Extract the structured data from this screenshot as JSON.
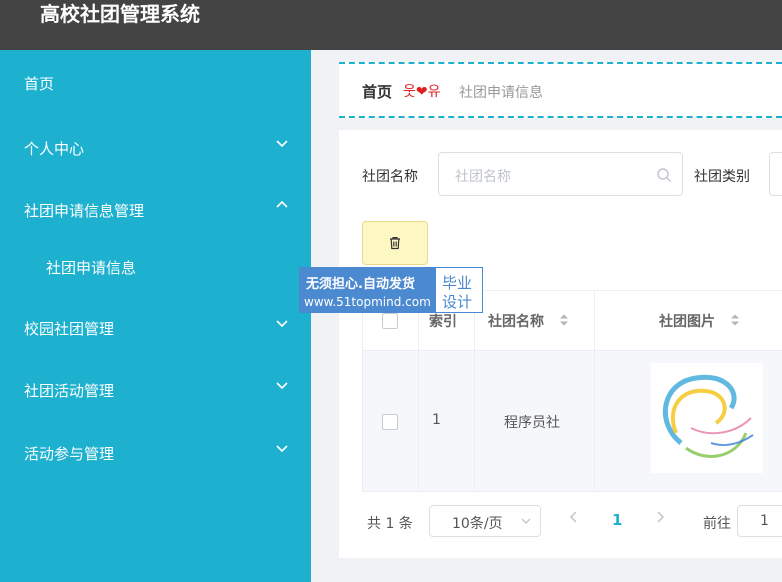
{
  "app": {
    "title": "高校社团管理系统"
  },
  "sidebar": {
    "items": [
      {
        "label": "首页"
      },
      {
        "label": "个人中心"
      },
      {
        "label": "社团申请信息管理"
      },
      {
        "label": "社团申请信息"
      },
      {
        "label": "校园社团管理"
      },
      {
        "label": "社团活动管理"
      },
      {
        "label": "活动参与管理"
      }
    ]
  },
  "breadcrumb": {
    "home": "首页",
    "separator": "웃❤유",
    "current": "社团申请信息"
  },
  "search": {
    "name_label": "社团名称",
    "name_placeholder": "社团名称",
    "type_label": "社团类别"
  },
  "table": {
    "headers": [
      "索引",
      "社团名称",
      "社团图片"
    ],
    "rows": [
      {
        "index": "1",
        "name": "程序员社"
      }
    ]
  },
  "pagination": {
    "total": "共 1 条",
    "page_size": "10条/页",
    "current_page": "1",
    "goto_label": "前往",
    "goto_value": "1"
  },
  "watermark": {
    "line1": "无须担心.自动发货",
    "line2": "www.51topmind.com",
    "right1": "毕业",
    "right2": "设计"
  },
  "colors": {
    "accent": "#1db1cf",
    "topbar": "#444444",
    "delete_button": "#fdf7c3"
  }
}
